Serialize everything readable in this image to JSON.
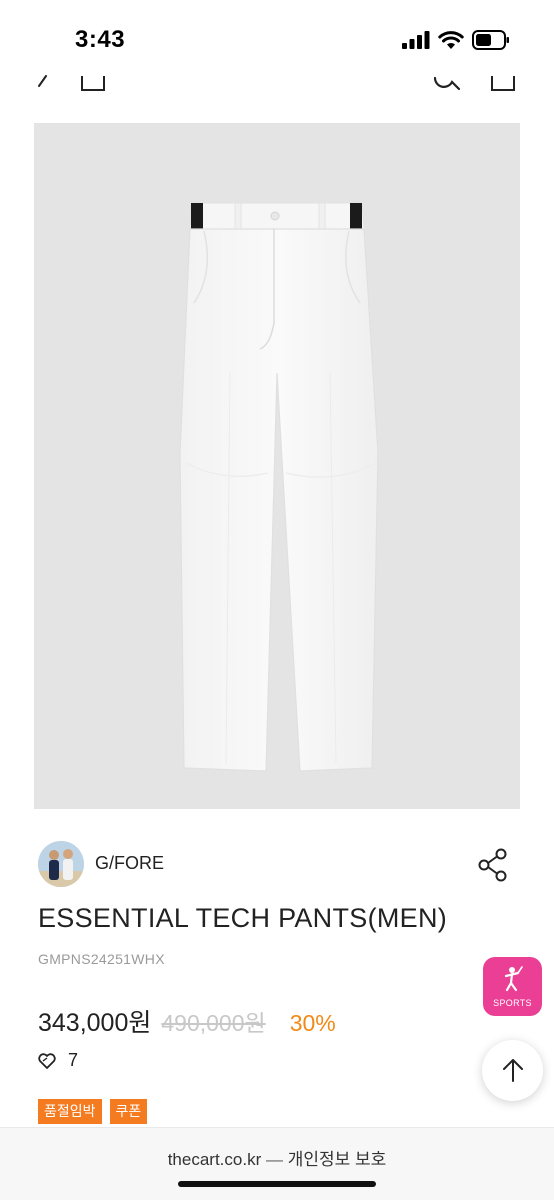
{
  "status_bar": {
    "time": "3:43"
  },
  "product": {
    "brand": "G/FORE",
    "title": "ESSENTIAL TECH PANTS(MEN)",
    "code": "GMPNS24251WHX",
    "sale_price": "343,000원",
    "original_price": "490,000원",
    "discount": "30%",
    "likes": "7",
    "badges": [
      "품절임박",
      "쿠폰"
    ]
  },
  "floating": {
    "sports_label": "SPORTS"
  },
  "browser_bar": {
    "domain": "thecart.co.kr",
    "separator": "—",
    "privacy": "개인정보 보호"
  },
  "colors": {
    "accent_orange": "#f47b20",
    "discount_orange": "#f08a16",
    "sports_pink": "#ea3f94",
    "image_bg": "#e4e4e4"
  }
}
